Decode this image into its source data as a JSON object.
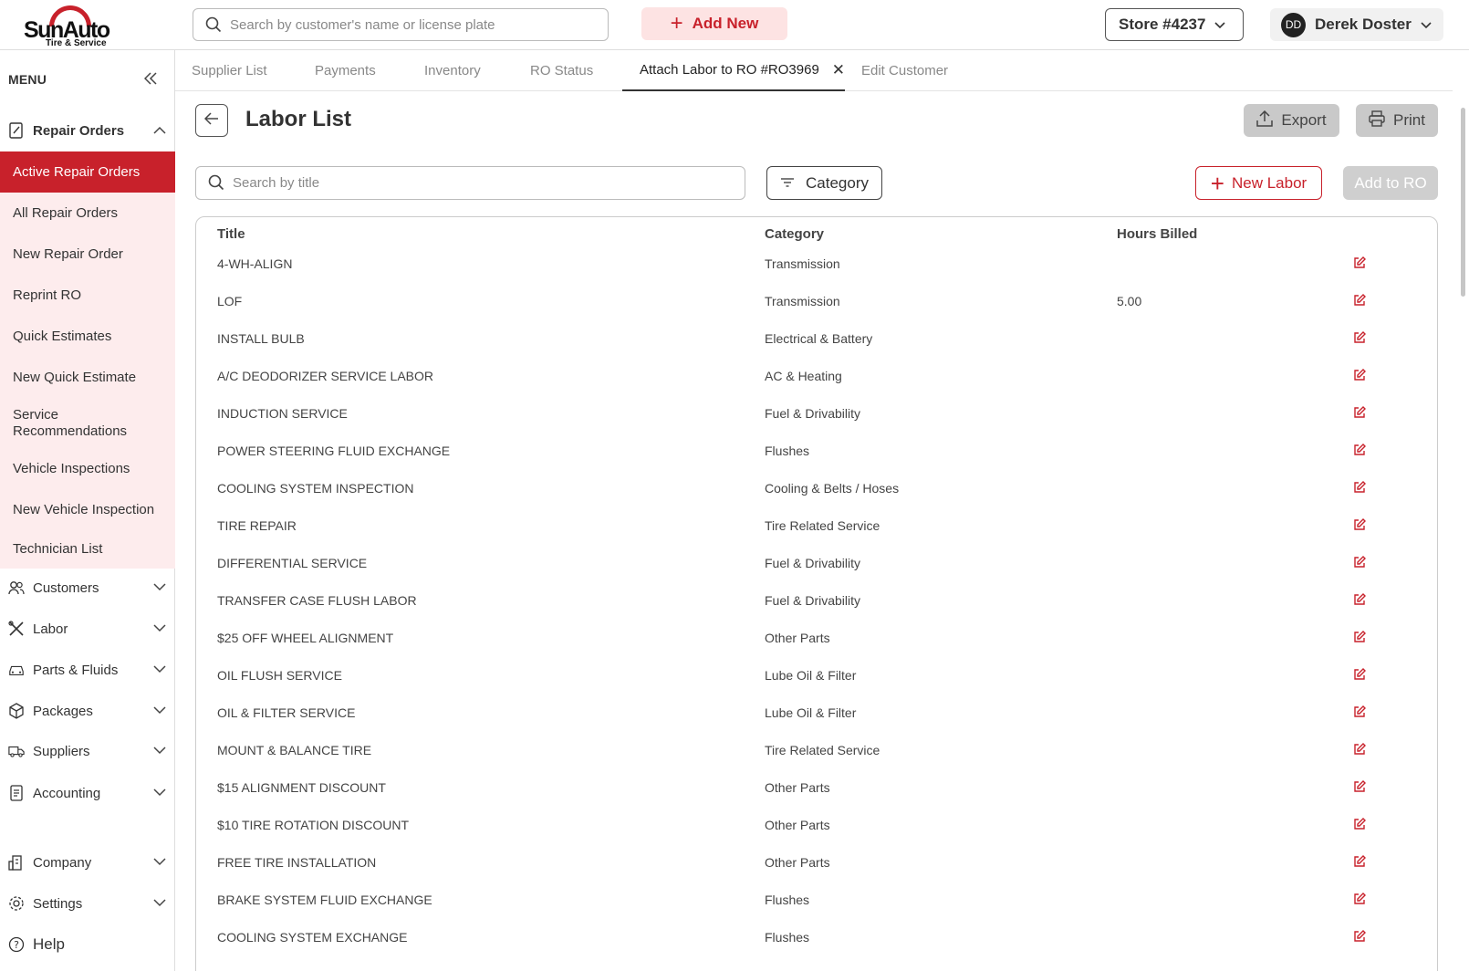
{
  "brand": {
    "name": "SunAuto",
    "tagline": "Tire & Service",
    "accent": "#c8212b"
  },
  "topbar": {
    "search_placeholder": "Search by customer's name or license plate",
    "add_new_label": "Add New",
    "store_label": "Store #4237",
    "user_initials": "DD",
    "user_name": "Derek Doster"
  },
  "sidebar": {
    "menu_label": "MENU",
    "repair_orders": {
      "label": "Repair Orders",
      "items": [
        "Active Repair Orders",
        "All Repair Orders",
        "New Repair Order",
        "Reprint RO",
        "Quick Estimates",
        "New Quick Estimate",
        "Service Recommendations",
        "Vehicle Inspections",
        "New Vehicle Inspection",
        "Technician List"
      ],
      "active_index": 0
    },
    "groups": [
      "Customers",
      "Labor",
      "Parts & Fluids",
      "Packages",
      "Suppliers",
      "Accounting"
    ],
    "bottom_groups": [
      "Company",
      "Settings"
    ],
    "help_label": "Help"
  },
  "tabs": {
    "items": [
      "Supplier List",
      "Payments",
      "Inventory",
      "RO Status",
      "Attach Labor to RO #RO3969",
      "Edit Customer"
    ],
    "active_index": 4
  },
  "page": {
    "title": "Labor List",
    "export_label": "Export",
    "print_label": "Print",
    "search_placeholder": "Search by title",
    "category_label": "Category",
    "new_labor_label": "New Labor",
    "add_to_ro_label": "Add to RO"
  },
  "table": {
    "columns": [
      "Title",
      "Category",
      "Hours Billed"
    ],
    "rows": [
      {
        "title": "4-WH-ALIGN",
        "category": "Transmission",
        "hours": ""
      },
      {
        "title": "LOF",
        "category": "Transmission",
        "hours": "5.00"
      },
      {
        "title": "INSTALL BULB",
        "category": "Electrical & Battery",
        "hours": ""
      },
      {
        "title": "A/C DEODORIZER SERVICE LABOR",
        "category": "AC & Heating",
        "hours": ""
      },
      {
        "title": "INDUCTION SERVICE",
        "category": "Fuel & Drivability",
        "hours": ""
      },
      {
        "title": "POWER STEERING FLUID EXCHANGE",
        "category": "Flushes",
        "hours": ""
      },
      {
        "title": "COOLING SYSTEM INSPECTION",
        "category": "Cooling & Belts / Hoses",
        "hours": ""
      },
      {
        "title": "TIRE REPAIR",
        "category": "Tire Related Service",
        "hours": ""
      },
      {
        "title": "DIFFERENTIAL SERVICE",
        "category": "Fuel & Drivability",
        "hours": ""
      },
      {
        "title": "TRANSFER CASE FLUSH LABOR",
        "category": "Fuel & Drivability",
        "hours": ""
      },
      {
        "title": "$25 OFF WHEEL ALIGNMENT",
        "category": "Other Parts",
        "hours": ""
      },
      {
        "title": "OIL FLUSH SERVICE",
        "category": "Lube Oil & Filter",
        "hours": ""
      },
      {
        "title": "OIL & FILTER SERVICE",
        "category": "Lube Oil & Filter",
        "hours": ""
      },
      {
        "title": "MOUNT & BALANCE TIRE",
        "category": "Tire Related Service",
        "hours": ""
      },
      {
        "title": "$15 ALIGNMENT DISCOUNT",
        "category": "Other Parts",
        "hours": ""
      },
      {
        "title": "$10 TIRE ROTATION DISCOUNT",
        "category": "Other Parts",
        "hours": ""
      },
      {
        "title": "FREE TIRE INSTALLATION",
        "category": "Other Parts",
        "hours": ""
      },
      {
        "title": "BRAKE SYSTEM FLUID EXCHANGE",
        "category": "Flushes",
        "hours": ""
      },
      {
        "title": "COOLING SYSTEM EXCHANGE",
        "category": "Flushes",
        "hours": ""
      }
    ]
  }
}
